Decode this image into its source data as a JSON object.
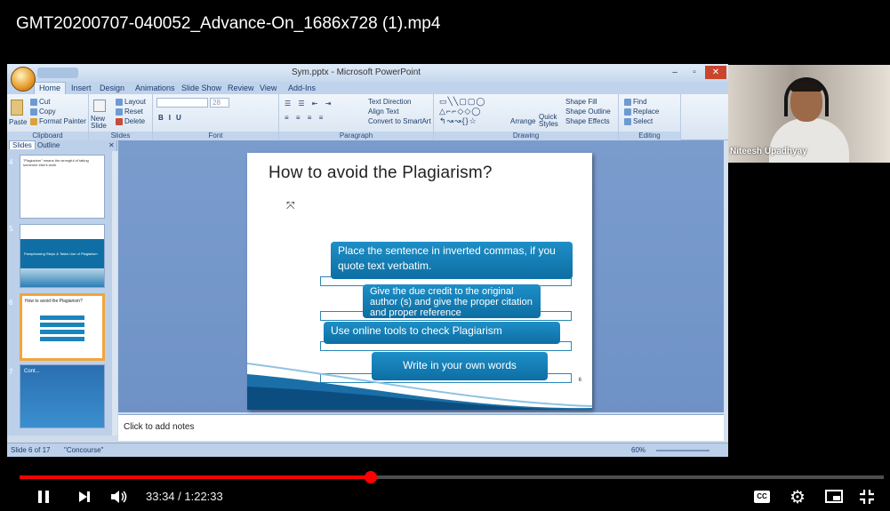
{
  "video": {
    "title": "GMT20200707-040052_Advance-On_1686x728 (1).mp4",
    "time": "33:34 / 1:22:33",
    "progress_fraction": 0.4066
  },
  "ppt": {
    "window_title": "Sym.pptx - Microsoft PowerPoint",
    "tabs": [
      "Home",
      "Insert",
      "Design",
      "Animations",
      "Slide Show",
      "Review",
      "View",
      "Add-Ins"
    ],
    "ribbon": {
      "clipboard": {
        "label": "Clipboard",
        "paste": "Paste",
        "cut": "Cut",
        "copy": "Copy",
        "format_painter": "Format Painter"
      },
      "slides": {
        "label": "Slides",
        "new_slide": "New Slide",
        "layout": "Layout",
        "reset": "Reset",
        "delete": "Delete"
      },
      "font": {
        "label": "Font",
        "size": "28"
      },
      "paragraph": {
        "label": "Paragraph",
        "text_direction": "Text Direction",
        "align_text": "Align Text",
        "convert": "Convert to SmartArt"
      },
      "drawing": {
        "label": "Drawing",
        "arrange": "Arrange",
        "quick_styles": "Quick Styles",
        "shape_fill": "Shape Fill",
        "shape_outline": "Shape Outline",
        "shape_effects": "Shape Effects"
      },
      "editing": {
        "label": "Editing",
        "find": "Find",
        "replace": "Replace",
        "select": "Select"
      }
    },
    "panel_tabs": {
      "slides": "Slides",
      "outline": "Outline"
    },
    "thumbnails": [
      {
        "num": "4",
        "text": "\"Plagiarism\" means the wrongful of taking someone else's work"
      },
      {
        "num": "5",
        "text": "Paraphrasing   Steps & Tasks   Use of Plagiarism"
      },
      {
        "num": "6",
        "text": "How to avoid the Plagiarism?"
      },
      {
        "num": "7",
        "text": "Cont..."
      }
    ],
    "slide": {
      "title": "How to avoid the Plagiarism?",
      "items": [
        "Place the sentence in inverted commas, if you quote text verbatim.",
        "Give the due credit to the original author (s) and give the proper citation and proper reference",
        "Use online tools to check Plagiarism",
        "Write in your own words"
      ],
      "page_number": "6"
    },
    "notes": "Click to add notes",
    "status": {
      "slide": "Slide 6 of 17",
      "theme": "\"Concourse\"",
      "zoom": "60%"
    }
  },
  "webcam": {
    "name": "Niteesh Upadhyay"
  },
  "controls": {
    "cc": "CC"
  }
}
